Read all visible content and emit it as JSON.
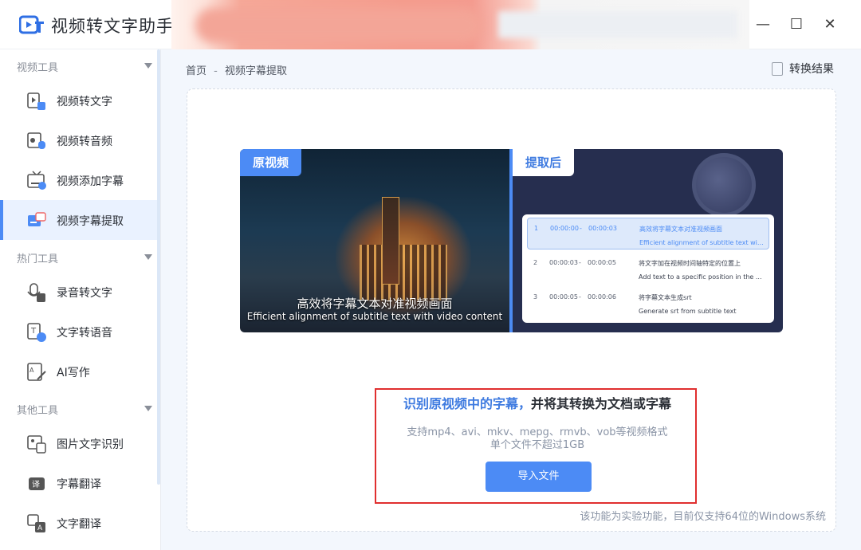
{
  "app": {
    "title": "视频转文字助手"
  },
  "sidebar": {
    "groups": [
      {
        "label": "视频工具"
      },
      {
        "label": "热门工具"
      },
      {
        "label": "其他工具"
      }
    ],
    "items": [
      {
        "label": "视频转文字",
        "icon": "video-text-icon"
      },
      {
        "label": "视频转音频",
        "icon": "video-audio-icon"
      },
      {
        "label": "视频添加字幕",
        "icon": "tv-subtitle-icon"
      },
      {
        "label": "视频字幕提取",
        "icon": "subtitle-extract-icon"
      },
      {
        "label": "录音转文字",
        "icon": "microphone-icon"
      },
      {
        "label": "文字转语音",
        "icon": "text-speech-icon"
      },
      {
        "label": "AI写作",
        "icon": "ai-writing-icon"
      },
      {
        "label": "图片文字识别",
        "icon": "image-ocr-icon"
      },
      {
        "label": "字幕翻译",
        "icon": "translate-badge-icon"
      },
      {
        "label": "文字翻译",
        "icon": "text-translate-icon"
      }
    ],
    "active_item": "视频字幕提取",
    "accent_color": "#4c8bf5"
  },
  "breadcrumb": {
    "home": "首页",
    "separator": "-",
    "current": "视频字幕提取"
  },
  "header": {
    "result_label": "转换结果"
  },
  "preview": {
    "left_tag": "原视频",
    "right_tag": "提取后",
    "subtitle_zh": "高效将字幕文本对准视频画面",
    "subtitle_en": "Efficient alignment of subtitle text with video content",
    "rows": [
      {
        "index": "1",
        "start": "00:00:00",
        "dash": "-",
        "end": "00:00:03",
        "zh": "高效将字幕文本对准视频画面",
        "en": "Efficient alignment of subtitle text with ..."
      },
      {
        "index": "2",
        "start": "00:00:03",
        "dash": "-",
        "end": "00:00:05",
        "zh": "将文字加在视频时间轴特定的位置上",
        "en": "Add text to a specific position in the ..."
      },
      {
        "index": "3",
        "start": "00:00:05",
        "dash": "-",
        "end": "00:00:06",
        "zh": "将字幕文本生成srt",
        "en": "Generate srt from subtitle text"
      }
    ]
  },
  "content": {
    "headline_highlight": "识别原视频中的字幕，",
    "headline_rest": "并将其转换为文档或字幕",
    "formats": "支持mp4、avi、mkv、mepg、rmvb、vob等视频格式",
    "limit": "单个文件不超过1GB",
    "import_button": "导入文件",
    "footnote": "该功能为实验功能，目前仅支持64位的Windows系统"
  },
  "window_controls": {
    "minimize": "—",
    "maximize": "☐",
    "close": "✕"
  },
  "colors": {
    "accent": "#4c8bf5",
    "highlight_text": "#3f7be0",
    "annotation_box": "#e02f2f"
  }
}
